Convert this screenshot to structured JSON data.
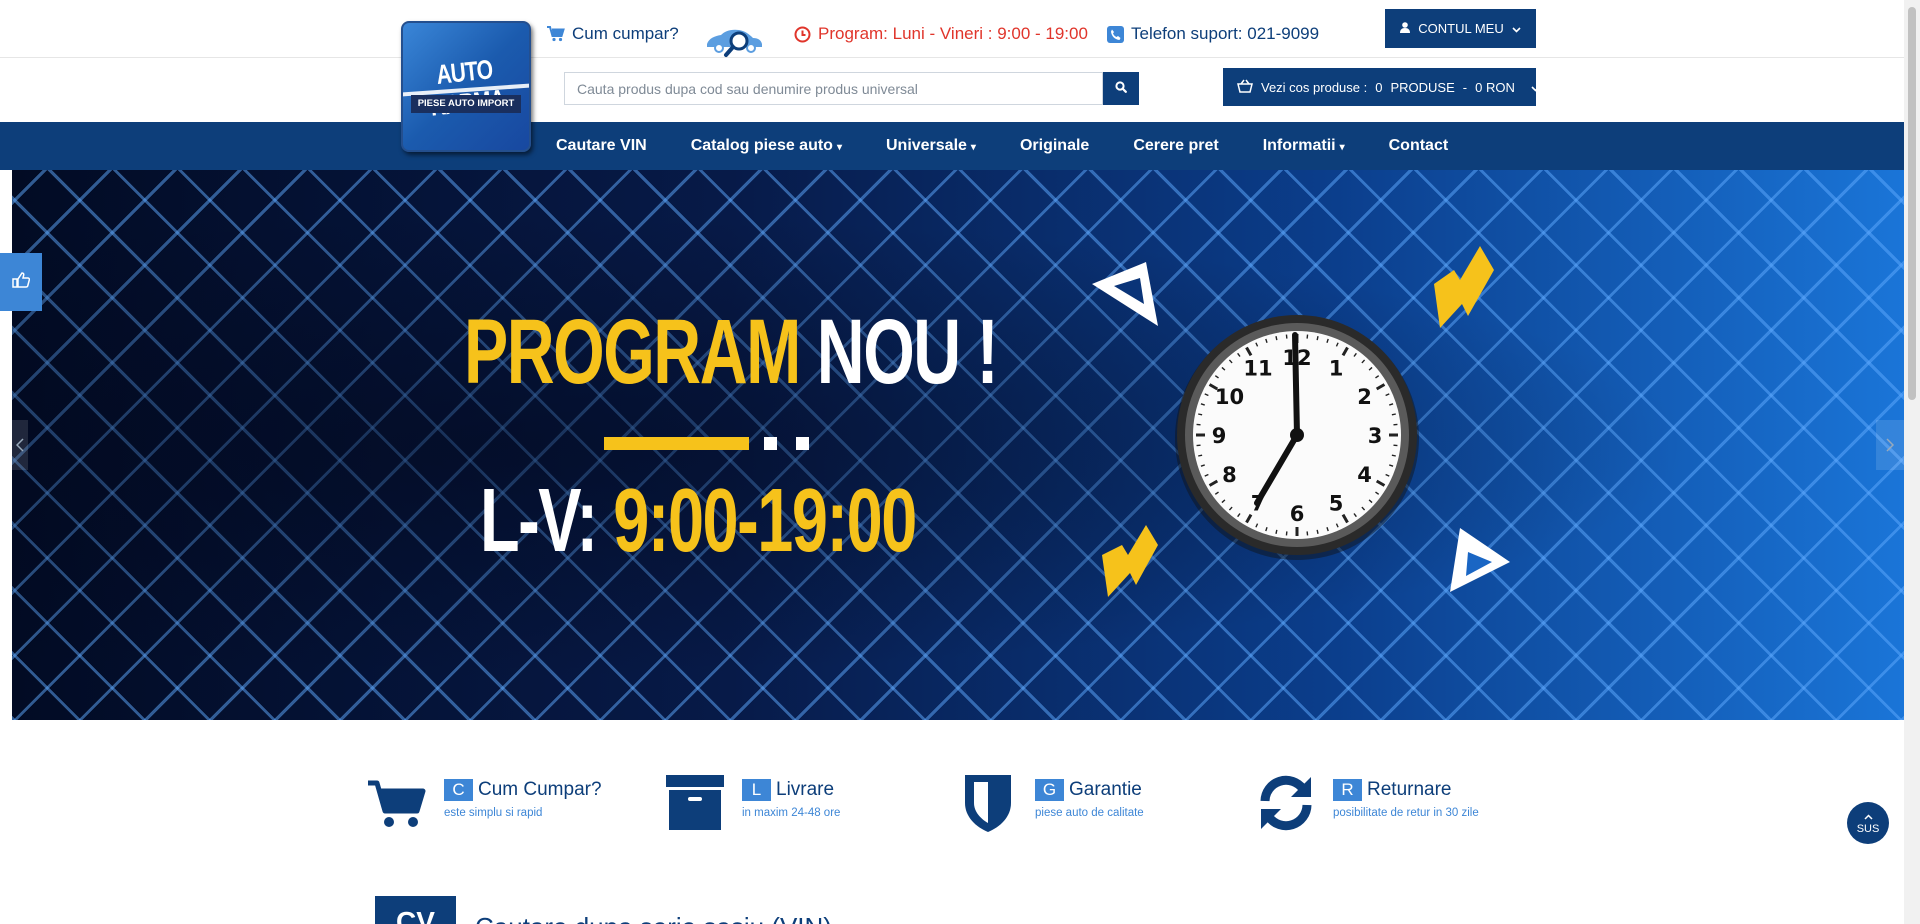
{
  "topbar": {
    "how_to_buy": "Cum cumpar?",
    "schedule": "Program: Luni - Vineri : 9:00 - 19:00",
    "phone": "Telefon suport: 021-9099",
    "account": "CONTUL MEU"
  },
  "logo": {
    "brand": "AUTO KARMA",
    "tagline": "PIESE AUTO IMPORT"
  },
  "search": {
    "placeholder": "Cauta produs dupa cod sau denumire produs universal"
  },
  "cart": {
    "label": "Vezi cos produse :",
    "count": "0",
    "products_word": "PRODUSE",
    "sep": "-",
    "total": "0 RON"
  },
  "nav": {
    "items": [
      {
        "label": "Cautare VIN",
        "dropdown": false
      },
      {
        "label": "Catalog piese auto",
        "dropdown": true
      },
      {
        "label": "Universale",
        "dropdown": true
      },
      {
        "label": "Originale",
        "dropdown": false
      },
      {
        "label": "Cerere pret",
        "dropdown": false
      },
      {
        "label": "Informatii",
        "dropdown": true
      },
      {
        "label": "Contact",
        "dropdown": false
      }
    ]
  },
  "hero": {
    "line1_a": "PROGRAM",
    "line1_b": "NOU !",
    "line2_a": "L-V:",
    "line2_b": "9:00-19:00",
    "clock_numbers": [
      "12",
      "1",
      "2",
      "3",
      "4",
      "5",
      "6",
      "7",
      "8",
      "9",
      "10",
      "11"
    ]
  },
  "features": [
    {
      "letter": "C",
      "title": "Cum Cumpar?",
      "subtitle": "este simplu si rapid",
      "icon": "cart-icon"
    },
    {
      "letter": "L",
      "title": "Livrare",
      "subtitle": "in maxim 24-48 ore",
      "icon": "box-icon"
    },
    {
      "letter": "G",
      "title": "Garantie",
      "subtitle": "piese auto de calitate",
      "icon": "shield-icon"
    },
    {
      "letter": "R",
      "title": "Returnare",
      "subtitle": "posibilitate de retur in 30 zile",
      "icon": "refresh-icon"
    }
  ],
  "back_to_top": "SUS",
  "section": {
    "badge": "CV",
    "title": "Cautare dupa serie sasiu (VIN)"
  },
  "colors": {
    "brand_blue": "#0d3e7a",
    "accent_blue": "#3d86d6",
    "alert_red": "#e0352b",
    "hero_yellow": "#f6c21b"
  }
}
